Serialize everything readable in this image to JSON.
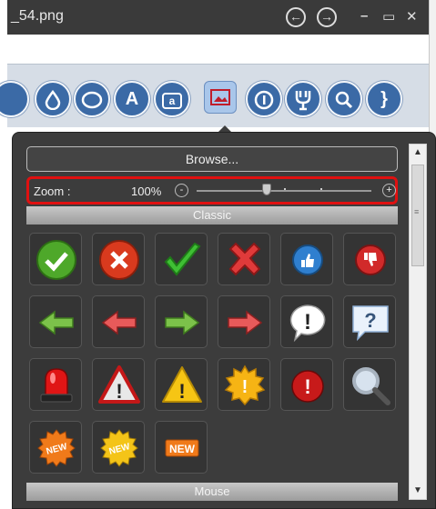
{
  "window": {
    "title": "_54.png",
    "back_icon": "arrow-left-circle-icon",
    "forward_icon": "arrow-right-circle-icon",
    "minimize": "–",
    "maximize": "▭",
    "close": "✕"
  },
  "ribbon": {
    "icons": [
      "drop-icon",
      "ellipse-icon",
      "text-icon",
      "callout-text-icon",
      "image-icon",
      "badge-icon",
      "flask-icon",
      "magnifier-icon",
      "brace-icon"
    ],
    "selected": "image-icon",
    "text_glyph": "A",
    "callout_glyph": "a"
  },
  "panel": {
    "browse_label": "Browse...",
    "zoom": {
      "label": "Zoom :",
      "value_text": "100%",
      "minus": "-",
      "plus": "+",
      "level": 0.4
    },
    "sections": [
      {
        "title": "Classic"
      },
      {
        "title": "Mouse"
      }
    ],
    "icons": [
      "check-circle-icon",
      "x-circle-icon",
      "checkmark-icon",
      "big-x-icon",
      "thumbs-up-icon",
      "thumbs-down-icon",
      "arrow-left-green-icon",
      "arrow-left-red-icon",
      "arrow-right-green-icon",
      "arrow-right-red-icon",
      "exclamation-bubble-icon",
      "question-bubble-icon",
      "siren-icon",
      "warning-triangle-red-icon",
      "warning-triangle-yellow-icon",
      "exclamation-starburst-icon",
      "exclamation-circle-red-icon",
      "magnifier-glass-icon",
      "new-badge-orange-icon",
      "new-badge-yellow-icon",
      "new-label-icon"
    ],
    "new_text": "NEW",
    "exclaim": "!",
    "question": "?"
  },
  "colors": {
    "popup_bg": "#3c3c3c",
    "accent_red": "#e01010",
    "ribbon_blue": "#3b6aa6"
  }
}
